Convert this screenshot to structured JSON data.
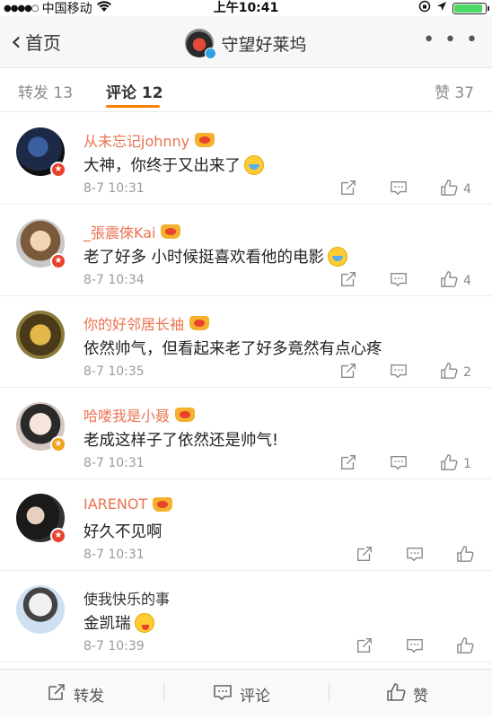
{
  "status_bar": {
    "signal": "●●●●○",
    "carrier": "中国移动",
    "wifi_icon": "wifi-icon",
    "time": "上午10:41",
    "battery_level": 0.9
  },
  "nav": {
    "back_label": "首页",
    "title": "守望好莱坞",
    "more_label": "• • •"
  },
  "tabs": [
    {
      "label": "转发 13",
      "active": false
    },
    {
      "label": "评论 12",
      "active": true
    },
    {
      "label": "赞 37",
      "active": false
    }
  ],
  "comments": [
    {
      "user": "从未忘记johnny",
      "vip": true,
      "text": "大神，你终于又出来了",
      "emoji": "cry",
      "time": "8-7 10:31",
      "likes": "4",
      "badge": "red"
    },
    {
      "user": "_張震倈Kai",
      "vip": true,
      "text": "老了好多 小时候挺喜欢看他的电影",
      "emoji": "cry",
      "time": "8-7 10:34",
      "likes": "4",
      "badge": "red"
    },
    {
      "user": "你的好邻居长袖",
      "vip": true,
      "text": "依然帅气，但看起来老了好多竟然有点心疼",
      "emoji": "",
      "time": "8-7 10:35",
      "likes": "2",
      "badge": ""
    },
    {
      "user": "哈喽我是小聂",
      "vip": true,
      "text": "老成这样子了依然还是帅气!",
      "emoji": "",
      "time": "8-7 10:31",
      "likes": "1",
      "badge": "orange"
    },
    {
      "user": "IARENOT",
      "vip": true,
      "text": "好久不见啊",
      "emoji": "",
      "time": "8-7 10:31",
      "likes": "",
      "badge": "red"
    },
    {
      "user": "使我快乐的事",
      "vip": false,
      "text": "金凯瑞",
      "emoji": "tongue",
      "time": "8-7 10:39",
      "likes": "",
      "badge": ""
    }
  ],
  "bottom_bar": {
    "repost_label": "转发",
    "comment_label": "评论",
    "like_label": "赞"
  },
  "colors": {
    "accent": "#ff8200",
    "username": "#eb7350",
    "muted": "#9a9a9a"
  }
}
